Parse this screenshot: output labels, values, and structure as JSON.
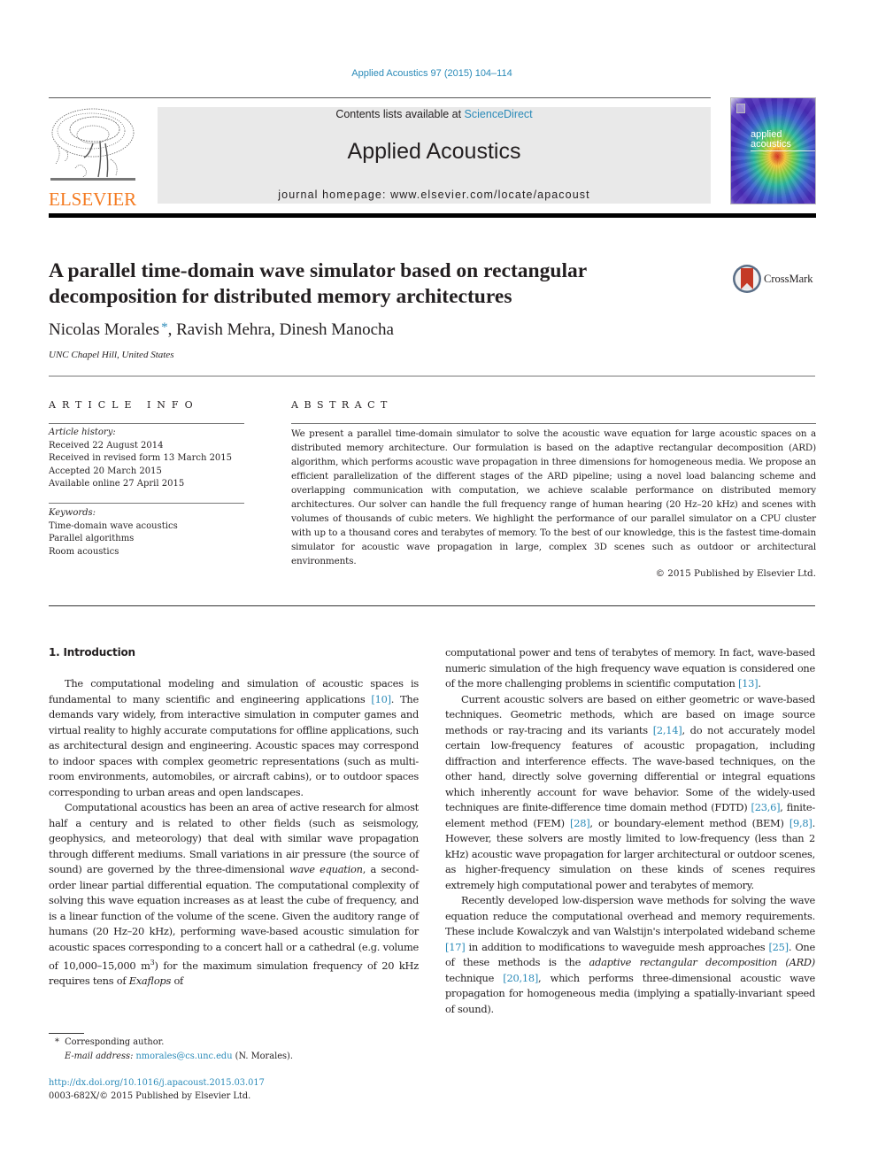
{
  "header": {
    "journal_ref": "Applied Acoustics 97 (2015) 104–114",
    "contents_prefix": "Contents lists available at ",
    "contents_link": "ScienceDirect",
    "journal_title": "Applied Acoustics",
    "homepage": "journal homepage: www.elsevier.com/locate/apacoust",
    "publisher_logo_text": "ELSEVIER",
    "cover_title_line1": "applied",
    "cover_title_line2": "acoustics",
    "colors": {
      "link": "#2a8ab8",
      "elsevier_orange": "#f47a20",
      "masthead_bg": "#e9e9e9"
    }
  },
  "article": {
    "title_line1": "A parallel time-domain wave simulator based on rectangular",
    "title_line2": "decomposition for distributed memory architectures",
    "crossmark_label": "CrossMark",
    "authors": {
      "author1": "Nicolas Morales",
      "author1_mark": "*",
      "rest": ", Ravish Mehra, Dinesh Manocha"
    },
    "affiliation": "UNC Chapel Hill, United States"
  },
  "article_info": {
    "label": "ARTICLE INFO",
    "history_heading": "Article history:",
    "history": [
      "Received 22 August 2014",
      "Received in revised form 13 March 2015",
      "Accepted 20 March 2015",
      "Available online 27 April 2015"
    ],
    "keywords_heading": "Keywords:",
    "keywords": [
      "Time-domain wave acoustics",
      "Parallel algorithms",
      "Room acoustics"
    ]
  },
  "abstract": {
    "label": "ABSTRACT",
    "text": "We present a parallel time-domain simulator to solve the acoustic wave equation for large acoustic spaces on a distributed memory architecture. Our formulation is based on the adaptive rectangular decomposition (ARD) algorithm, which performs acoustic wave propagation in three dimensions for homogeneous media. We propose an efficient parallelization of the different stages of the ARD pipeline; using a novel load balancing scheme and overlapping communication with computation, we achieve scalable performance on distributed memory architectures. Our solver can handle the full frequency range of human hearing (20 Hz–20 kHz) and scenes with volumes of thousands of cubic meters. We highlight the performance of our parallel simulator on a CPU cluster with up to a thousand cores and terabytes of memory. To the best of our knowledge, this is the fastest time-domain simulator for acoustic wave propagation in large, complex 3D scenes such as outdoor or architectural environments.",
    "copyright": "© 2015 Published by Elsevier Ltd."
  },
  "body": {
    "section_heading": "1. Introduction",
    "left": {
      "p1_a": "The computational modeling and simulation of acoustic spaces is fundamental to many scientific and engineering applications ",
      "p1_ref1": "[10]",
      "p1_b": ". The demands vary widely, from interactive simulation in computer games and virtual reality to highly accurate computations for offline applications, such as architectural design and engineering. Acoustic spaces may correspond to indoor spaces with complex geometric representations (such as multi-room environments, automobiles, or aircraft cabins), or to outdoor spaces corresponding to urban areas and open landscapes.",
      "p2_a": "Computational acoustics has been an area of active research for almost half a century and is related to other fields (such as seismology, geophysics, and meteorology) that deal with similar wave propagation through different mediums. Small variations in air pressure (the source of sound) are governed by the three-dimensional ",
      "p2_em": "wave equation",
      "p2_b": ", a second-order linear partial differential equation. The computational complexity of solving this wave equation increases as at least the cube of frequency, and is a linear function of the volume of the scene. Given the auditory range of humans (20 Hz–20 kHz), performing wave-based acoustic simulation for acoustic spaces corresponding to a concert hall or a cathedral (e.g. volume of 10,000–15,000 m",
      "p2_sup": "3",
      "p2_c": ") for the maximum simulation frequency of 20 kHz requires tens of ",
      "p2_em2": "Exaflops",
      "p2_d": " of"
    },
    "right": {
      "p1_a": "computational power and tens of terabytes of memory. In fact, wave-based numeric simulation of the high frequency wave equation is considered one of the more challenging problems in scientific computation ",
      "p1_ref": "[13]",
      "p1_b": ".",
      "p2_a": "Current acoustic solvers are based on either geometric or wave-based techniques. Geometric methods, which are based on image source methods or ray-tracing and its variants ",
      "p2_ref1": "[2,14]",
      "p2_b": ", do not accurately model certain low-frequency features of acoustic propagation, including diffraction and interference effects. The wave-based techniques, on the other hand, directly solve governing differential or integral equations which inherently account for wave behavior. Some of the widely-used techniques are finite-difference time domain method (FDTD) ",
      "p2_ref2": "[23,6]",
      "p2_c": ", finite-element method (FEM) ",
      "p2_ref3": "[28]",
      "p2_d": ", or boundary-element method (BEM) ",
      "p2_ref4": "[9,8]",
      "p2_e": ". However, these solvers are mostly limited to low-frequency (less than 2 kHz) acoustic wave propagation for larger architectural or outdoor scenes, as higher-frequency simulation on these kinds of scenes requires extremely high computational power and terabytes of memory.",
      "p3_a": "Recently developed low-dispersion wave methods for solving the wave equation reduce the computational overhead and memory requirements. These include Kowalczyk and van Walstijn's interpolated wideband scheme ",
      "p3_ref1": "[17]",
      "p3_b": " in addition to modifications to waveguide mesh approaches ",
      "p3_ref2": "[25]",
      "p3_c": ". One of these methods is the ",
      "p3_em": "adaptive rectangular decomposition (ARD)",
      "p3_d": " technique ",
      "p3_ref3": "[20,18]",
      "p3_e": ", which performs three-dimensional acoustic wave propagation for homogeneous media (implying a spatially-invariant speed of sound)."
    }
  },
  "footnotes": {
    "corresponding_mark": "*",
    "corresponding": "Corresponding author.",
    "email_label": "E-mail address: ",
    "email": "nmorales@cs.unc.edu",
    "email_suffix": " (N. Morales).",
    "doi": "http://dx.doi.org/10.1016/j.apacoust.2015.03.017",
    "issn": "0003-682X/© 2015 Published by Elsevier Ltd."
  }
}
